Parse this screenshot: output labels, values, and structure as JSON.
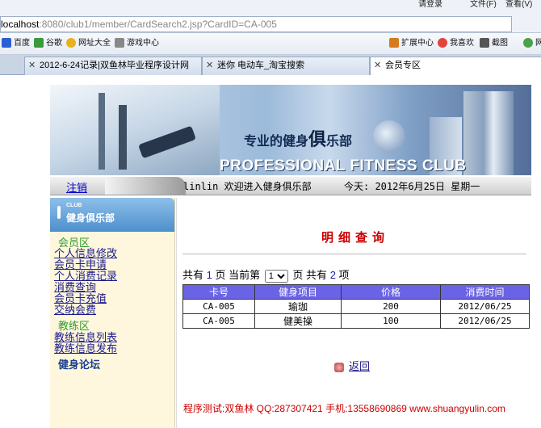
{
  "browser": {
    "top_links": {
      "login": "请登录",
      "file": "文件(F)",
      "view": "查看(V)"
    },
    "address_host": "localhost",
    "address_rest": ":8080/club1/member/CardSearch2.jsp?CardID=CA-005",
    "favorites": [
      "百度",
      "谷歌",
      "网址大全",
      "游戏中心"
    ],
    "right_tools": [
      "扩展中心",
      "我喜欢",
      "截图",
      "网"
    ],
    "tabs": [
      {
        "label": "2012-6-24记录|双鱼林毕业程序设计网"
      },
      {
        "label": "迷你 电动车_淘宝搜索"
      },
      {
        "label": "会员专区"
      }
    ]
  },
  "banner": {
    "slogan_a": "专业的健身",
    "slogan_big": "俱",
    "slogan_b": "乐部",
    "title": "PROFESSIONAL FITNESS CLUB"
  },
  "navbar": {
    "logout": "注销",
    "welcome": "linlin 欢迎进入健身俱乐部",
    "today": "今天:  2012年6月25日 星期一"
  },
  "sidebar": {
    "club": "CLUB",
    "heading": "健身俱乐部",
    "member_section": "会员区",
    "member_links": [
      "个人信息修改",
      "会员卡申请",
      "个人消费记录",
      "消费查询",
      "会员卡充值",
      "交纳会费"
    ],
    "coach_section": "教练区",
    "coach_links": [
      "教练信息列表",
      "教练信息发布"
    ],
    "forum": "健身论坛"
  },
  "main": {
    "title": "明细查询",
    "pager": {
      "total_prefix": "共有",
      "total_pages": "1",
      "page_unit": "页",
      "current_label": "当前第",
      "current_value": "1",
      "items_prefix": "共有",
      "items": "2",
      "items_unit": "项"
    },
    "table": {
      "headers": [
        "卡号",
        "健身项目",
        "价格",
        "消费时间"
      ],
      "rows": [
        [
          "CA-005",
          "瑜珈",
          "200",
          "2012/06/25"
        ],
        [
          "CA-005",
          "健美操",
          "100",
          "2012/06/25"
        ]
      ]
    },
    "back": "返回",
    "footer": "程序测试:双鱼林 QQ:287307421 手机:13558690869 www.shuangyulin.com"
  }
}
